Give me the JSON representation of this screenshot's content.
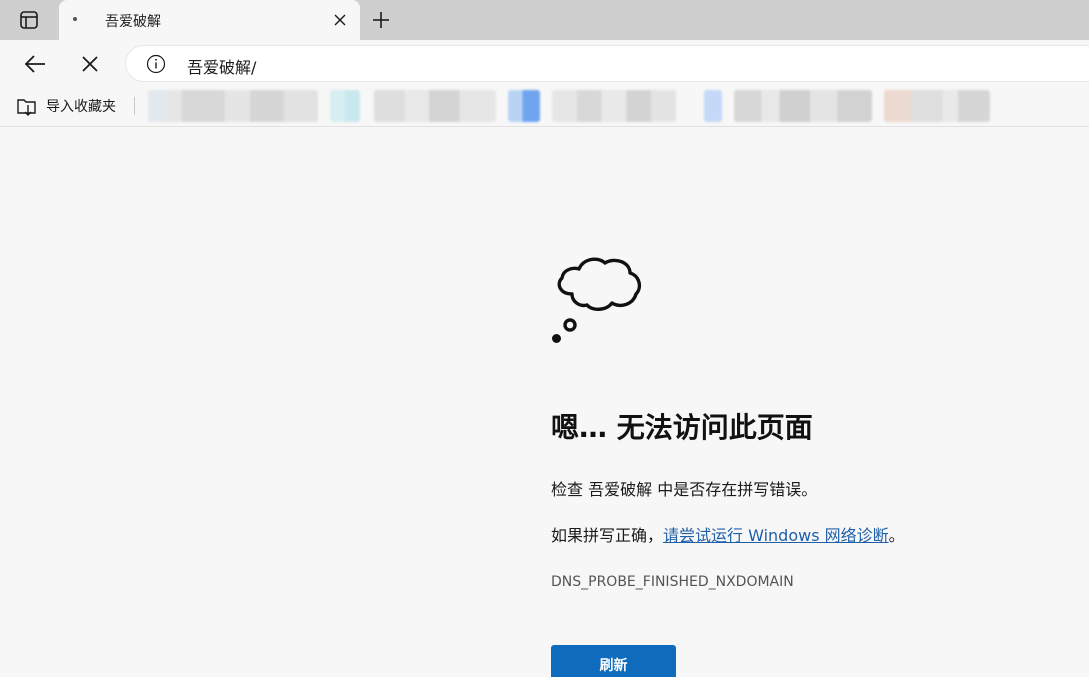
{
  "tab": {
    "title": "吾爱破解"
  },
  "address_bar": {
    "url": "吾爱破解/"
  },
  "favorites_bar": {
    "import_label": "导入收藏夹"
  },
  "error_page": {
    "title": "嗯… 无法访问此页面",
    "check_prefix": "检查",
    "check_host": "吾爱破解",
    "check_suffix": "中是否存在拼写错误。",
    "spelling_prefix": "如果拼写正确，",
    "diagnose_link": "请尝试运行 Windows 网络诊断",
    "spelling_suffix": "。",
    "error_code": "DNS_PROBE_FINISHED_NXDOMAIN",
    "refresh_label": "刷新"
  },
  "colors": {
    "accent": "#0f6cbd",
    "link": "#1f5fa8",
    "tabstrip": "#cfcfcf",
    "page_bg": "#f7f7f7"
  },
  "icons": {
    "tab_actions": "tab-actions-icon",
    "close_tab": "close-icon",
    "new_tab": "plus-icon",
    "back": "arrow-left-icon",
    "stop": "close-icon",
    "site_info": "info-icon",
    "import_favorites": "folder-import-icon",
    "error_illustration": "thought-cloud-icon"
  }
}
